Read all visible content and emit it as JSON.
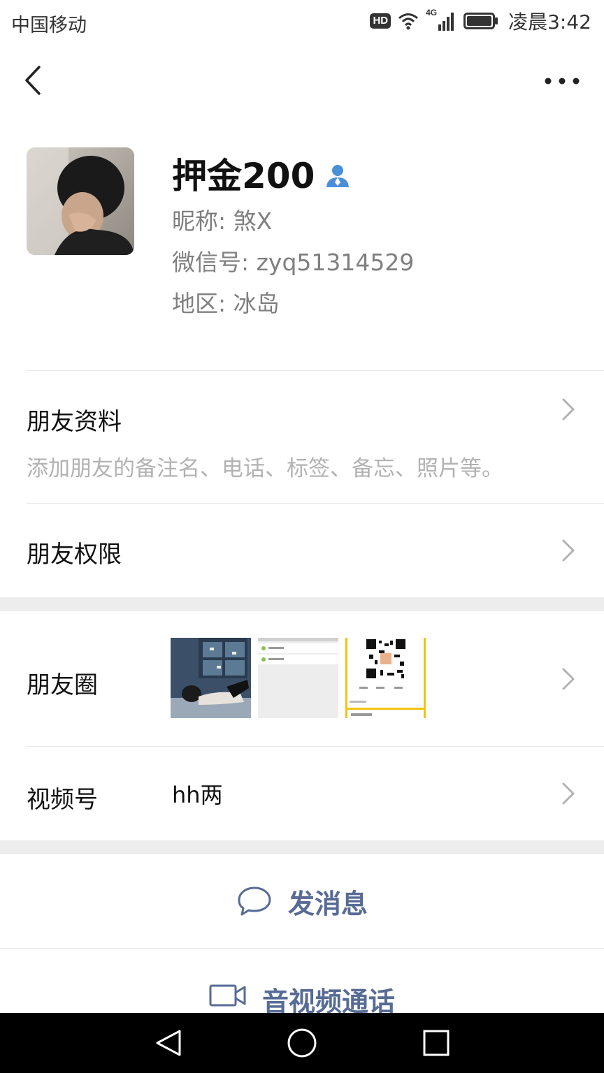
{
  "status_bar": {
    "carrier": "中国移动",
    "hd_label": "HD",
    "network": "4G",
    "time": "凌晨3:42"
  },
  "nav": {
    "back_icon": "chevron-left-icon",
    "more_icon": "more-dots-icon"
  },
  "profile": {
    "name": "押金200",
    "nickname_line": "昵称:  煞X",
    "wechat_id_line": "微信号:  zyq51314529",
    "region_line": "地区:  冰岛"
  },
  "friend_info": {
    "title": "朋友资料",
    "subtitle": "添加朋友的备注名、电话、标签、备忘、照片等。"
  },
  "friend_permissions": {
    "title": "朋友权限"
  },
  "moments": {
    "title": "朋友圈"
  },
  "channels": {
    "title": "视频号",
    "value": "hh两"
  },
  "actions": {
    "message": "发消息",
    "call": "音视频通话"
  },
  "colors": {
    "link": "#576b95",
    "gap": "#ededed",
    "gender_male": "#4a90d9"
  }
}
